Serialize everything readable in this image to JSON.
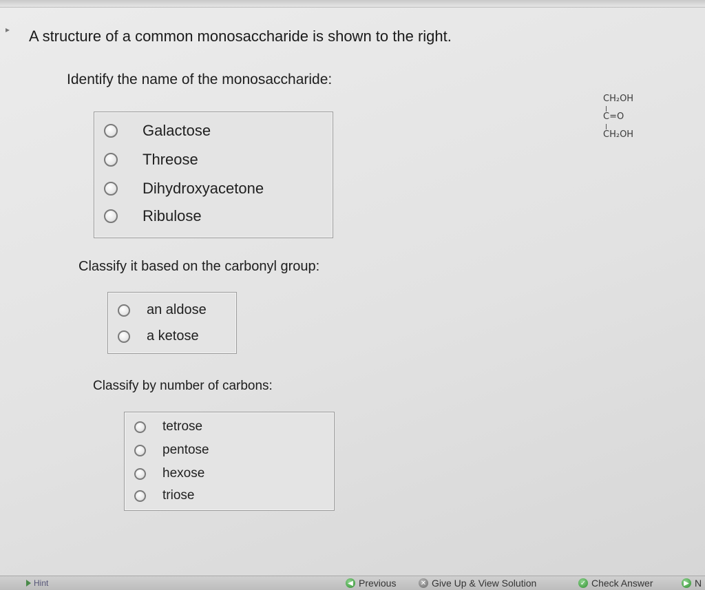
{
  "question": {
    "text": "A structure of a common monosaccharide is shown to the right."
  },
  "sections": [
    {
      "prompt": "Identify the name of the monosaccharide:",
      "options": [
        "Galactose",
        "Threose",
        "Dihydroxyacetone",
        "Ribulose"
      ]
    },
    {
      "prompt": "Classify it based on the carbonyl group:",
      "options": [
        "an aldose",
        "a ketose"
      ]
    },
    {
      "prompt": "Classify by number of carbons:",
      "options": [
        "tetrose",
        "pentose",
        "hexose",
        "triose"
      ]
    }
  ],
  "structure": {
    "top": "CH₂OH",
    "middle": "C=O",
    "bottom": "CH₂OH"
  },
  "footer": {
    "hint": "Hint",
    "previous": "Previous",
    "give_up": "Give Up & View Solution",
    "check_answer": "Check Answer",
    "next": "N"
  }
}
